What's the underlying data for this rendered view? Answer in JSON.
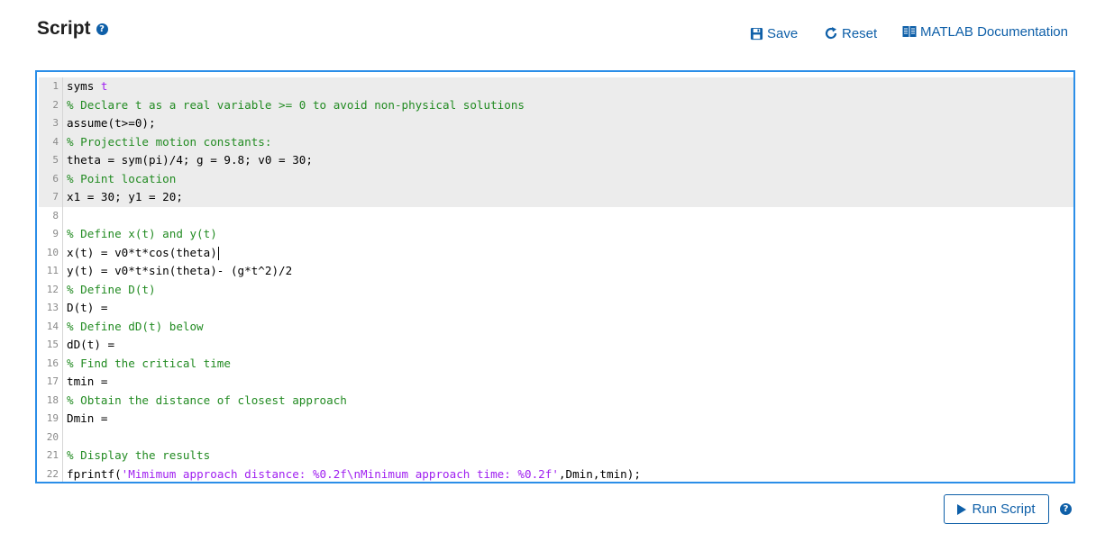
{
  "header": {
    "title": "Script",
    "help_icon": "question-circle-icon"
  },
  "toolbar": {
    "save_label": "Save",
    "reset_label": "Reset",
    "doc_label": "MATLAB Documentation"
  },
  "editor": {
    "lines": [
      {
        "num": "1",
        "locked": true,
        "type": "code",
        "text": "syms ",
        "extra": "t"
      },
      {
        "num": "2",
        "locked": true,
        "type": "comment",
        "text": "% Declare t as a real variable >= 0 to avoid non-physical solutions"
      },
      {
        "num": "3",
        "locked": true,
        "type": "code",
        "text": "assume(t>=0);"
      },
      {
        "num": "4",
        "locked": true,
        "type": "comment",
        "text": "% Projectile motion constants:"
      },
      {
        "num": "5",
        "locked": true,
        "type": "code",
        "text": "theta = sym(pi)/4; g = 9.8; v0 = 30;"
      },
      {
        "num": "6",
        "locked": true,
        "type": "comment",
        "text": "% Point location"
      },
      {
        "num": "7",
        "locked": true,
        "type": "code",
        "text": "x1 = 30; y1 = 20;"
      },
      {
        "num": "8",
        "locked": false,
        "type": "code",
        "text": ""
      },
      {
        "num": "9",
        "locked": false,
        "type": "comment",
        "text": "% Define x(t) and y(t)"
      },
      {
        "num": "10",
        "locked": false,
        "type": "code",
        "text": "x(t) = v0*t*cos(theta)"
      },
      {
        "num": "11",
        "locked": false,
        "type": "code",
        "text": "y(t) = v0*t*sin(theta)- (g*t^2)/2"
      },
      {
        "num": "12",
        "locked": false,
        "type": "comment",
        "text": "% Define D(t)"
      },
      {
        "num": "13",
        "locked": false,
        "type": "code",
        "text": "D(t) ="
      },
      {
        "num": "14",
        "locked": false,
        "type": "comment",
        "text": "% Define dD(t) below"
      },
      {
        "num": "15",
        "locked": false,
        "type": "code",
        "text": "dD(t) ="
      },
      {
        "num": "16",
        "locked": false,
        "type": "comment",
        "text": "% Find the critical time"
      },
      {
        "num": "17",
        "locked": false,
        "type": "code",
        "text": "tmin ="
      },
      {
        "num": "18",
        "locked": false,
        "type": "comment",
        "text": "% Obtain the distance of closest approach"
      },
      {
        "num": "19",
        "locked": false,
        "type": "code",
        "text": "Dmin ="
      },
      {
        "num": "20",
        "locked": false,
        "type": "code",
        "text": ""
      },
      {
        "num": "21",
        "locked": false,
        "type": "comment",
        "text": "% Display the results"
      },
      {
        "num": "22",
        "locked": false,
        "type": "code",
        "text": "fprintf(",
        "str": "'Mimimum approach distance: %0.2f\\nMinimum approach time: %0.2f'",
        "after": ",Dmin,tmin);"
      }
    ]
  },
  "footer": {
    "run_label": "Run Script"
  },
  "colors": {
    "accent": "#0e5fa8",
    "editor_border": "#2b8ee8",
    "comment": "#228b22",
    "string": "#a020f0",
    "locked_bg": "#ececec"
  }
}
